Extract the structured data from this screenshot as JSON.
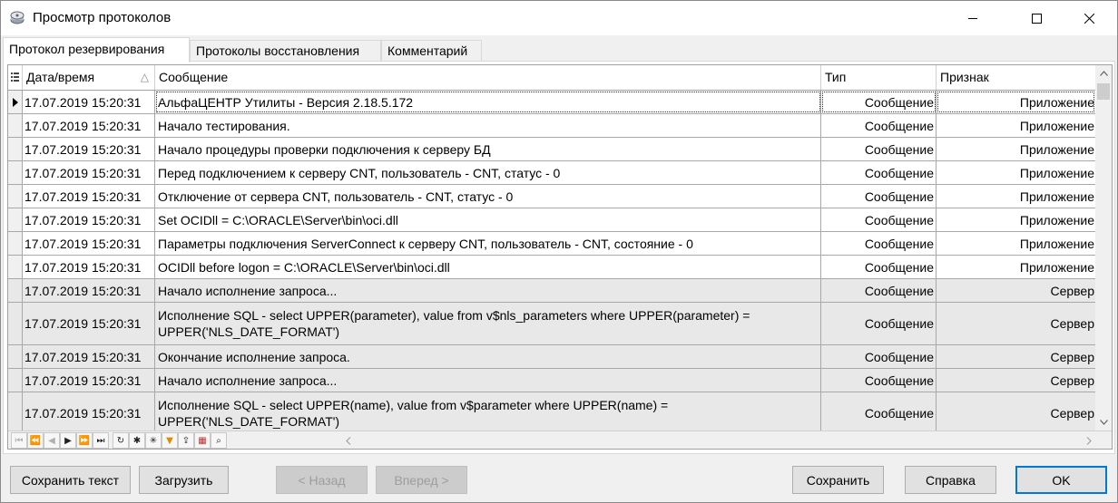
{
  "window": {
    "title": "Просмотр протоколов",
    "icon": "disk-app-icon",
    "controls": [
      "minimize-icon",
      "maximize-icon",
      "close-icon"
    ]
  },
  "tabs": [
    {
      "label": "Протокол резервирования",
      "active": true
    },
    {
      "label": "Протоколы восстановления",
      "active": false
    },
    {
      "label": "Комментарий",
      "active": false
    }
  ],
  "grid": {
    "columns": {
      "datetime": "Дата/время",
      "message": "Сообщение",
      "type": "Тип",
      "sign": "Признак"
    },
    "sort_indicator": "△",
    "rows": [
      {
        "datetime": "17.07.2019 15:20:31",
        "message": "АльфаЦЕНТР Утилиты - Версия 2.18.5.172",
        "type": "Сообщение",
        "sign": "Приложение",
        "selected": true
      },
      {
        "datetime": "17.07.2019 15:20:31",
        "message": "Начало тестирования.",
        "type": "Сообщение",
        "sign": "Приложение"
      },
      {
        "datetime": "17.07.2019 15:20:31",
        "message": "Начало процедуры проверки подключения к серверу БД",
        "type": "Сообщение",
        "sign": "Приложение"
      },
      {
        "datetime": "17.07.2019 15:20:31",
        "message": "Перед подключением к серверу CNT, пользователь - CNT, статус - 0",
        "type": "Сообщение",
        "sign": "Приложение"
      },
      {
        "datetime": "17.07.2019 15:20:31",
        "message": "Отключение от сервера CNT, пользователь - CNT, статус - 0",
        "type": "Сообщение",
        "sign": "Приложение"
      },
      {
        "datetime": "17.07.2019 15:20:31",
        "message": "Set OCIDll = C:\\ORACLE\\Server\\bin\\oci.dll",
        "type": "Сообщение",
        "sign": "Приложение"
      },
      {
        "datetime": "17.07.2019 15:20:31",
        "message": "Параметры подключения ServerConnect к серверу CNT, пользователь - CNT, состояние - 0",
        "type": "Сообщение",
        "sign": "Приложение"
      },
      {
        "datetime": "17.07.2019 15:20:31",
        "message": "OCIDll before logon = C:\\ORACLE\\Server\\bin\\oci.dll",
        "type": "Сообщение",
        "sign": "Приложение"
      },
      {
        "datetime": "17.07.2019 15:20:31",
        "message": "Начало исполнение запроса...",
        "type": "Сообщение",
        "sign": "Сервер",
        "gray": true
      },
      {
        "datetime": "17.07.2019 15:20:31",
        "message": "Исполнение SQL - select UPPER(parameter), value from v$nls_parameters where UPPER(parameter) = UPPER('NLS_DATE_FORMAT')",
        "type": "Сообщение",
        "sign": "Сервер",
        "gray": true,
        "tall": true
      },
      {
        "datetime": "17.07.2019 15:20:31",
        "message": "Окончание исполнение запроса.",
        "type": "Сообщение",
        "sign": "Сервер",
        "gray": true
      },
      {
        "datetime": "17.07.2019 15:20:31",
        "message": "Начало исполнение запроса...",
        "type": "Сообщение",
        "sign": "Сервер",
        "gray": true
      },
      {
        "datetime": "17.07.2019 15:20:31",
        "message": "Исполнение SQL - select UPPER(name), value from v$parameter where UPPER(name) = UPPER('NLS_DATE_FORMAT')",
        "type": "Сообщение",
        "sign": "Сервер",
        "gray": true,
        "tall": true
      }
    ]
  },
  "navigator": {
    "buttons": [
      {
        "name": "first-page-icon",
        "glyph": "⏮"
      },
      {
        "name": "prior-page-icon",
        "glyph": "⏪"
      },
      {
        "name": "prior-record-icon",
        "glyph": "◀"
      },
      {
        "name": "next-record-icon",
        "glyph": "▶"
      },
      {
        "name": "next-page-icon",
        "glyph": "⏩"
      },
      {
        "name": "last-page-icon",
        "glyph": "⏭"
      },
      {
        "name": "refresh-icon",
        "glyph": "↻"
      },
      {
        "name": "insert-icon",
        "glyph": "✱"
      },
      {
        "name": "delete-icon",
        "glyph": "✳"
      },
      {
        "name": "filter-icon",
        "glyph": "▼"
      },
      {
        "name": "export-icon",
        "glyph": "⇪"
      },
      {
        "name": "grid-settings-icon",
        "glyph": "▦"
      },
      {
        "name": "find-icon",
        "glyph": "⌕"
      }
    ]
  },
  "buttons": {
    "save_text": "Сохранить текст",
    "load": "Загрузить",
    "back": "< Назад",
    "forward": "Вперед >",
    "save": "Сохранить",
    "help": "Справка",
    "ok": "OK"
  },
  "colors": {
    "accent": "#0078d7",
    "gray_row": "#e8e8e8",
    "grid_line": "#a8a8a8"
  }
}
